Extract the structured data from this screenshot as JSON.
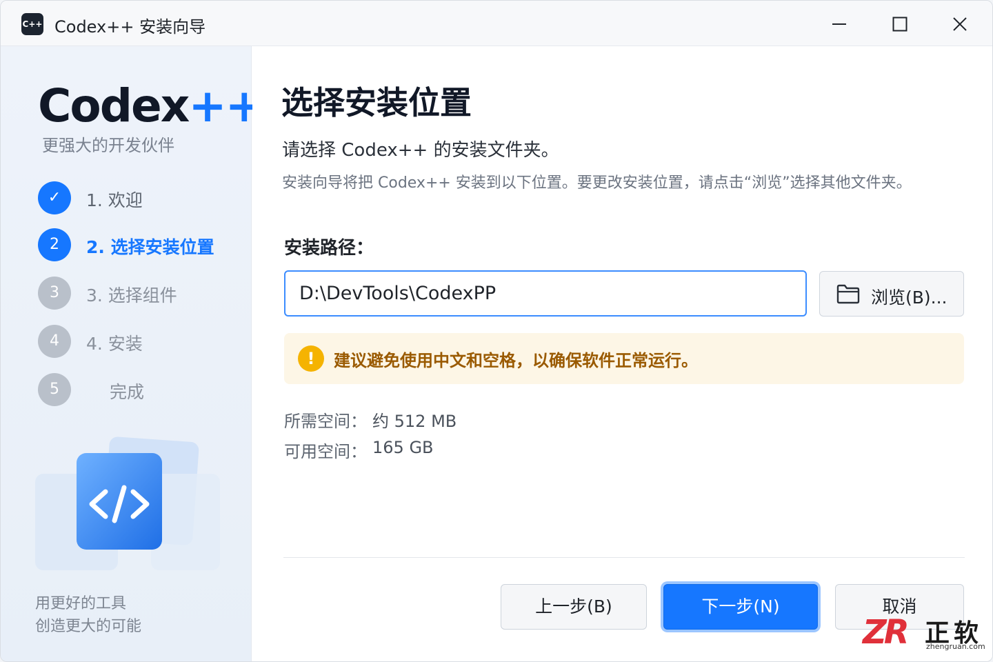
{
  "window": {
    "icon_text": "C++",
    "title": "Codex++ 安装向导"
  },
  "sidebar": {
    "brand_main": "Codex",
    "brand_suffix": "++",
    "tagline": "更强大的开发伙伴",
    "steps": [
      {
        "num": "✓",
        "label": "1.  欢迎",
        "state": "done"
      },
      {
        "num": "2",
        "label": "2.  选择安装位置",
        "state": "active"
      },
      {
        "num": "3",
        "label": "3.  选择组件",
        "state": "pending"
      },
      {
        "num": "4",
        "label": "4.  安装",
        "state": "pending"
      },
      {
        "num": "5",
        "label": "完成",
        "state": "pending"
      }
    ],
    "slogan_line1": "用更好的工具",
    "slogan_line2": "创造更大的可能"
  },
  "main": {
    "title": "选择安装位置",
    "subtitle": "请选择 Codex++ 的安装文件夹。",
    "description": "安装向导将把 Codex++ 安装到以下位置。要更改安装位置，请点击“浏览”选择其他文件夹。",
    "path_label": "安装路径：",
    "path_value": "D:\\DevTools\\CodexPP",
    "browse_label": "浏览(B)...",
    "warning_text": "建议避免使用中文和空格，以确保软件正常运行。",
    "required_label": "所需空间：",
    "required_value": "约 512 MB",
    "available_label": "可用空间：",
    "available_value": "165 GB"
  },
  "buttons": {
    "back": "上一步(B)",
    "next": "下一步(N)",
    "cancel": "取消"
  },
  "watermark": {
    "logo": "ZR",
    "name": "正软",
    "domain": "zhengruan.com"
  },
  "colors": {
    "accent": "#1677ff",
    "warning_bg": "#fdf6e6",
    "warning_text": "#9a5a00",
    "sidebar_bg": "#eef3fa"
  }
}
